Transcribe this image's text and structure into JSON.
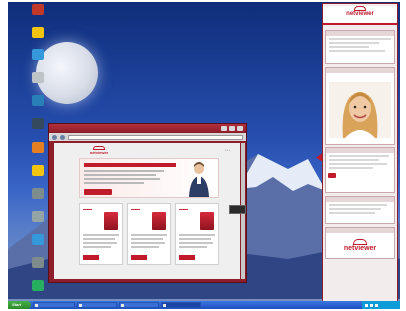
{
  "desktop": {
    "icons": [
      {
        "label": "",
        "color": "#c0392b"
      },
      {
        "label": "",
        "color": "#f1c40f"
      },
      {
        "label": "",
        "color": "#3498db"
      },
      {
        "label": "",
        "color": "#bdc3c7"
      },
      {
        "label": "",
        "color": "#2980b9"
      },
      {
        "label": "",
        "color": "#34495e"
      },
      {
        "label": "",
        "color": "#e67e22"
      },
      {
        "label": "",
        "color": "#f1c40f"
      },
      {
        "label": "",
        "color": "#7f8c8d"
      },
      {
        "label": "",
        "color": "#95a5a6"
      },
      {
        "label": "",
        "color": "#3498db"
      },
      {
        "label": "",
        "color": "#7f8c8d"
      },
      {
        "label": "",
        "color": "#27ae60"
      }
    ]
  },
  "browser": {
    "title": "",
    "address": "",
    "site": {
      "brand": "netviewer"
    }
  },
  "netviewer_panel": {
    "brand": "netviewer",
    "sections": [
      {
        "header": "",
        "key": "settings"
      },
      {
        "header": "",
        "key": "video"
      },
      {
        "header": "",
        "key": "chat"
      },
      {
        "header": "",
        "key": "transfer"
      },
      {
        "header": "",
        "key": "about"
      }
    ],
    "footer_brand": "netviewer"
  },
  "taskbar": {
    "start_label": "Start",
    "tasks": [
      {
        "label": ""
      },
      {
        "label": ""
      },
      {
        "label": ""
      },
      {
        "label": "",
        "active": true
      }
    ],
    "clock": ""
  },
  "colors": {
    "brand_red": "#c01b2b",
    "taskbar_blue": "#1d50c2",
    "start_green": "#2a8a2a"
  }
}
